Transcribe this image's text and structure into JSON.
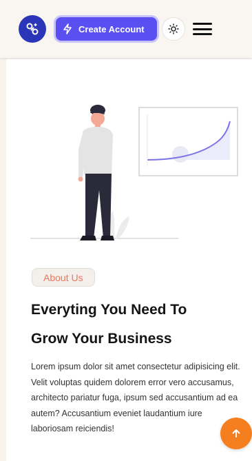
{
  "header": {
    "logo_icon": "link-nodes-icon",
    "cta_label": "Create Account",
    "cta_icon": "lightning-icon",
    "theme_icon": "sun-icon",
    "menu_icon": "hamburger-icon"
  },
  "about": {
    "badge": "About Us",
    "heading_line1": "Everyting You Need To",
    "heading_line2": "Grow Your Business",
    "body": "Lorem ipsum dolor sit amet consectetur adipisicing elit. Velit voluptas quidem dolorem error vero accusamus, architecto pariatur fuga, ipsum sed accusantium ad ea autem? Accusantium eveniet laudantium iure laboriosam reiciendis!"
  },
  "scroll_top_icon": "arrow-up-icon",
  "colors": {
    "brand_blue": "#2b35b8",
    "cta_purple": "#5a4ff0",
    "accent_orange": "#f57f1e",
    "badge_text": "#f0745a"
  }
}
